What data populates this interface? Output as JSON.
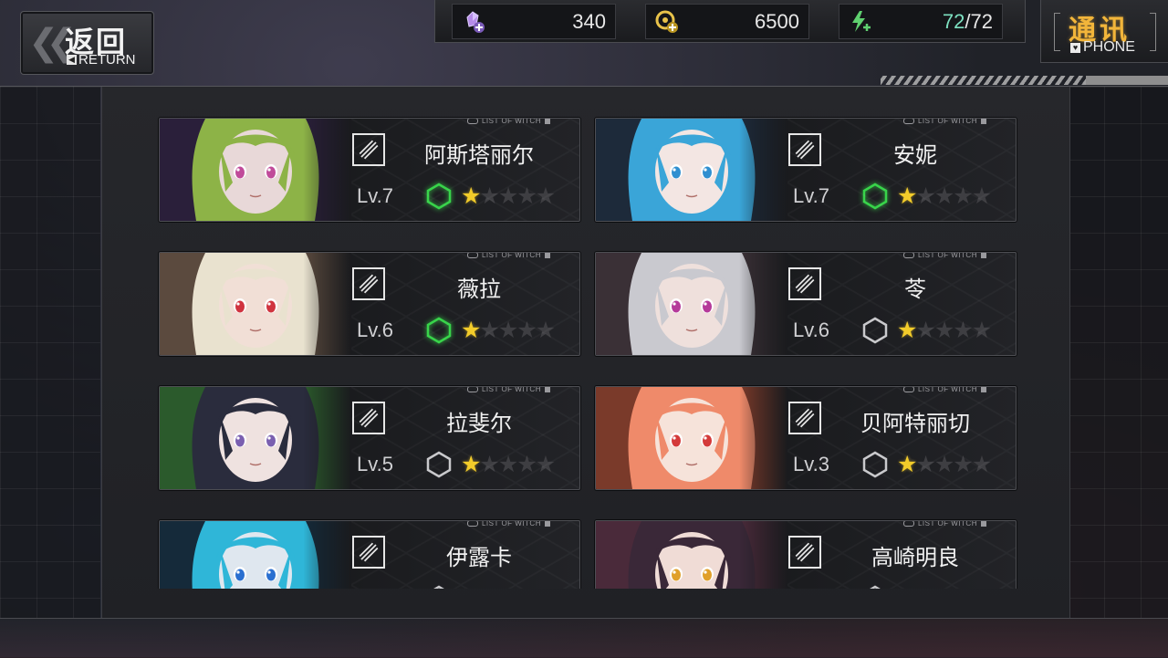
{
  "top_bar": {
    "return_cn": "返回",
    "return_en": "RETURN",
    "phone_cn": "通讯",
    "phone_en": "PHONE"
  },
  "resources": [
    {
      "name": "crystal-icon",
      "value": "340",
      "color": "#b58be8"
    },
    {
      "name": "coin-icon",
      "value": "6500",
      "color": "#e8c24a"
    },
    {
      "name": "energy-icon",
      "current": "72",
      "max": "/72",
      "color": "#5fd06f"
    }
  ],
  "card_tag": "LIST OF WITCH",
  "witches": [
    {
      "name": "阿斯塔丽尔",
      "level": "Lv.7",
      "hex": "green",
      "stars": 1,
      "max_stars": 5,
      "hair": "#8db347",
      "skin": "#e8d8d8",
      "eye": "#c04a9a",
      "bg": "#2a1f3a"
    },
    {
      "name": "安妮",
      "level": "Lv.7",
      "hex": "green",
      "stars": 1,
      "max_stars": 5,
      "hair": "#3aa5d8",
      "skin": "#f3e6e3",
      "eye": "#2f8fd0",
      "bg": "#1d2a3a"
    },
    {
      "name": "薇拉",
      "level": "Lv.6",
      "hex": "green",
      "stars": 1,
      "max_stars": 5,
      "hair": "#e9e2cf",
      "skin": "#f1dfd6",
      "eye": "#d0333f",
      "bg": "#5b4a3e"
    },
    {
      "name": "苓",
      "level": "Lv.6",
      "hex": "white",
      "stars": 1,
      "max_stars": 5,
      "hair": "#c9c9cf",
      "skin": "#efe0dc",
      "eye": "#b53a9a",
      "bg": "#3a3036"
    },
    {
      "name": "拉斐尔",
      "level": "Lv.5",
      "hex": "white",
      "stars": 1,
      "max_stars": 5,
      "hair": "#2a2c3d",
      "skin": "#efe2e0",
      "eye": "#7a5fb0",
      "bg": "#2b5a2c"
    },
    {
      "name": "贝阿特丽切",
      "level": "Lv.3",
      "hex": "white",
      "stars": 1,
      "max_stars": 5,
      "hair": "#ef8a6a",
      "skin": "#f6e3da",
      "eye": "#d43a3a",
      "bg": "#7a3a2a"
    },
    {
      "name": "伊露卡",
      "level": "",
      "hex": "white",
      "stars": 0,
      "max_stars": 0,
      "hair": "#2fb6d8",
      "skin": "#dfe7ef",
      "eye": "#2a6fd0",
      "bg": "#152a3a"
    },
    {
      "name": "高崎明良",
      "level": "",
      "hex": "white",
      "stars": 0,
      "max_stars": 0,
      "hair": "#3a2838",
      "skin": "#f0dcd6",
      "eye": "#e0a02a",
      "bg": "#4a2a3a"
    }
  ]
}
